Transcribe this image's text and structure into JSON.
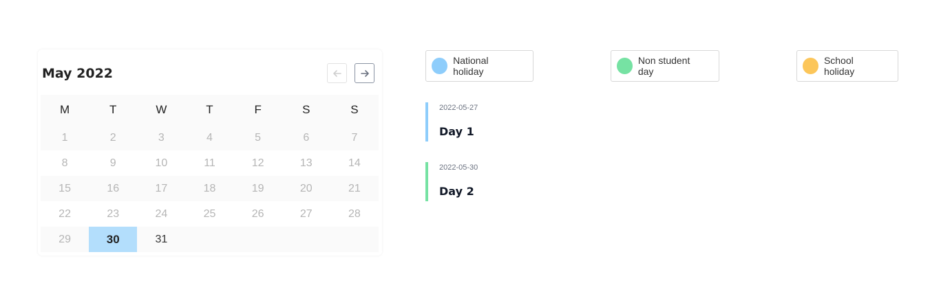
{
  "calendar": {
    "title": "May 2022",
    "weekdays": [
      "M",
      "T",
      "W",
      "T",
      "F",
      "S",
      "S"
    ],
    "weeks": [
      [
        "1",
        "2",
        "3",
        "4",
        "5",
        "6",
        "7"
      ],
      [
        "8",
        "9",
        "10",
        "11",
        "12",
        "13",
        "14"
      ],
      [
        "15",
        "16",
        "17",
        "18",
        "19",
        "20",
        "21"
      ],
      [
        "22",
        "23",
        "24",
        "25",
        "26",
        "27",
        "28"
      ],
      [
        "29",
        "30",
        "31",
        "",
        "",
        "",
        ""
      ]
    ],
    "selected_day": "30",
    "prev_icon": "arrow-left-icon",
    "next_icon": "arrow-right-icon"
  },
  "legend": [
    {
      "label": "National holiday",
      "color": "#8ecdfb"
    },
    {
      "label": "Non student day",
      "color": "#76e2a3"
    },
    {
      "label": "School holiday",
      "color": "#fcc65a"
    }
  ],
  "events": [
    {
      "date": "2022-05-27",
      "title": "Day 1",
      "color": "#8ecdfb"
    },
    {
      "date": "2022-05-30",
      "title": "Day 2",
      "color": "#76e2a3"
    }
  ]
}
